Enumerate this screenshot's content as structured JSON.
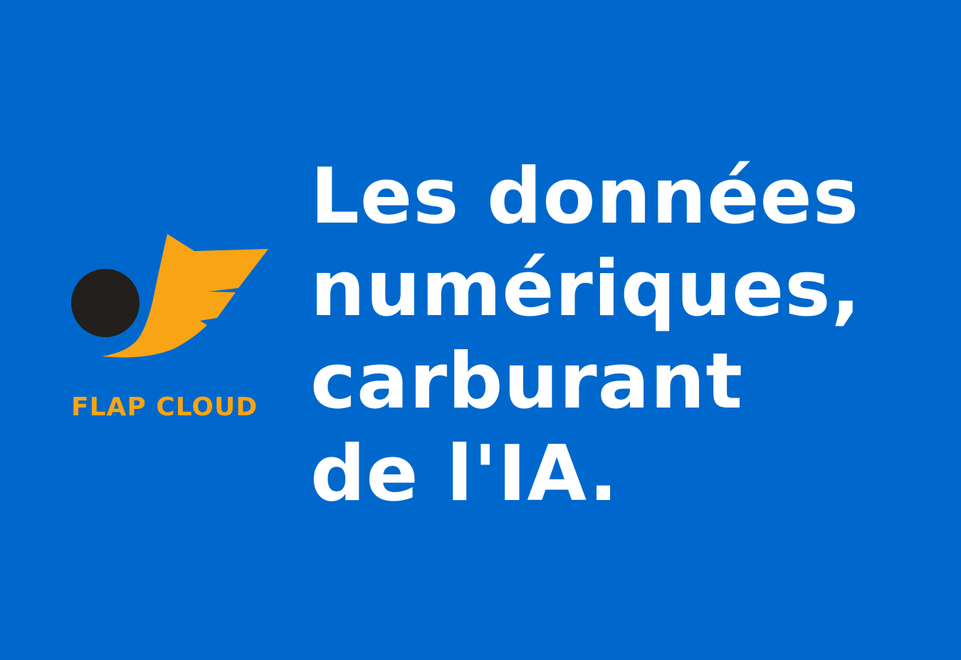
{
  "colors": {
    "background": "#0068cc",
    "accent": "#f9a414",
    "dark": "#221f1c",
    "text": "#ffffff"
  },
  "logo": {
    "icon": "flap-cloud-wing-logo-icon",
    "name": "FLAP CLOUD"
  },
  "headline": {
    "lines": [
      "Les données",
      "numériques,",
      "carburant",
      "de l'IA."
    ]
  }
}
